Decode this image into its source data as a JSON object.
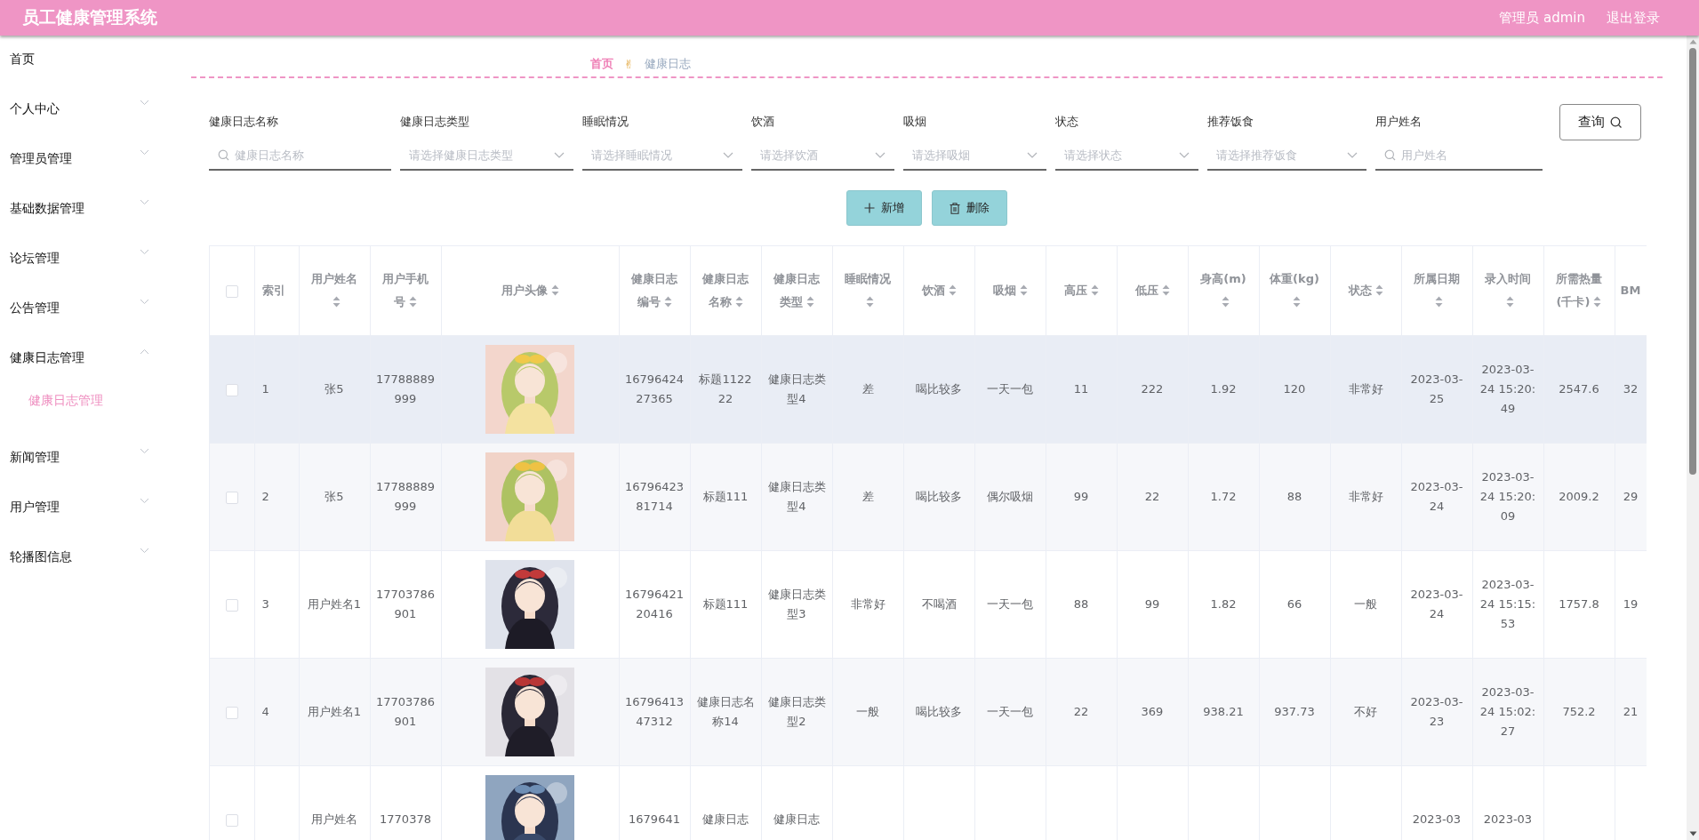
{
  "header": {
    "title": "员工健康管理系统",
    "user": "管理员 admin",
    "logout": "退出登录"
  },
  "sidebar": {
    "items": [
      {
        "label": "首页",
        "kind": "link"
      },
      {
        "label": "个人中心",
        "kind": "menu",
        "expanded": false
      },
      {
        "label": "管理员管理",
        "kind": "menu",
        "expanded": false
      },
      {
        "label": "基础数据管理",
        "kind": "menu",
        "expanded": false
      },
      {
        "label": "论坛管理",
        "kind": "menu",
        "expanded": false
      },
      {
        "label": "公告管理",
        "kind": "menu",
        "expanded": false
      },
      {
        "label": "健康日志管理",
        "kind": "menu",
        "expanded": true,
        "children": [
          {
            "label": "健康日志管理",
            "selected": true
          }
        ]
      },
      {
        "label": "新闻管理",
        "kind": "menu",
        "expanded": false
      },
      {
        "label": "用户管理",
        "kind": "menu",
        "expanded": false
      },
      {
        "label": "轮播图信息",
        "kind": "menu",
        "expanded": false
      }
    ]
  },
  "breadcrumb": {
    "items": [
      "首页",
      "健康日志"
    ],
    "separator": "✌"
  },
  "filters": [
    {
      "label": "健康日志名称",
      "kind": "search",
      "placeholder": "健康日志名称"
    },
    {
      "label": "健康日志类型",
      "kind": "select",
      "placeholder": "请选择健康日志类型"
    },
    {
      "label": "睡眠情况",
      "kind": "select",
      "placeholder": "请选择睡眠情况"
    },
    {
      "label": "饮酒",
      "kind": "select",
      "placeholder": "请选择饮酒"
    },
    {
      "label": "吸烟",
      "kind": "select",
      "placeholder": "请选择吸烟"
    },
    {
      "label": "状态",
      "kind": "select",
      "placeholder": "请选择状态"
    },
    {
      "label": "推荐饭食",
      "kind": "select",
      "placeholder": "请选择推荐饭食"
    },
    {
      "label": "用户姓名",
      "kind": "search",
      "placeholder": "用户姓名"
    }
  ],
  "query_button": "查询",
  "actions": [
    {
      "label": "新增",
      "kind": "add"
    },
    {
      "label": "删除",
      "kind": "delete"
    }
  ],
  "table": {
    "select_all": {
      "checked": false
    },
    "columns": [
      {
        "label": "索引",
        "sortable": false
      },
      {
        "label": "用户姓名",
        "sortable": true
      },
      {
        "label": "用户手机号",
        "sortable": true
      },
      {
        "label": "用户头像",
        "sortable": true
      },
      {
        "label": "健康日志编号",
        "sortable": true
      },
      {
        "label": "健康日志名称",
        "sortable": true
      },
      {
        "label": "健康日志类型",
        "sortable": true
      },
      {
        "label": "睡眠情况",
        "sortable": true
      },
      {
        "label": "饮酒",
        "sortable": true
      },
      {
        "label": "吸烟",
        "sortable": true
      },
      {
        "label": "高压",
        "sortable": true
      },
      {
        "label": "低压",
        "sortable": true
      },
      {
        "label": "身高(m)",
        "sortable": true
      },
      {
        "label": "体重(kg)",
        "sortable": true
      },
      {
        "label": "状态",
        "sortable": true
      },
      {
        "label": "所属日期",
        "sortable": true
      },
      {
        "label": "录入时间",
        "sortable": true
      },
      {
        "label": "所需热量(千卡)",
        "sortable": true
      },
      {
        "label": "BM",
        "sortable": false
      }
    ],
    "rows": [
      {
        "checked": false,
        "hovered": true,
        "cells": [
          "1",
          "张5",
          "17788889999",
          {
            "kind": "picture"
          },
          "1679642427365",
          "标题112222",
          "健康日志类型4",
          "差",
          "喝比较多",
          "一天一包",
          "11",
          "222",
          "1.92",
          "120",
          "非常好",
          "2023-03-25",
          "2023-03-24 15:20:49",
          "2547.6",
          "32"
        ]
      },
      {
        "checked": false,
        "hovered": false,
        "cells": [
          "2",
          "张5",
          "17788889999",
          {
            "kind": "picture"
          },
          "1679642381714",
          "标题111",
          "健康日志类型4",
          "差",
          "喝比较多",
          "偶尔吸烟",
          "99",
          "22",
          "1.72",
          "88",
          "非常好",
          "2023-03-24",
          "2023-03-24 15:20:09",
          "2009.2",
          "29"
        ]
      },
      {
        "checked": false,
        "hovered": false,
        "cells": [
          "3",
          "用户姓名1",
          "17703786901",
          {
            "kind": "picture"
          },
          "1679642120416",
          "标题111",
          "健康日志类型3",
          "非常好",
          "不喝酒",
          "一天一包",
          "88",
          "99",
          "1.82",
          "66",
          "一般",
          "2023-03-24",
          "2023-03-24 15:15:53",
          "1757.8",
          "19"
        ]
      },
      {
        "checked": false,
        "hovered": false,
        "cells": [
          "4",
          "用户姓名1",
          "17703786901",
          {
            "kind": "picture"
          },
          "1679641347312",
          "健康日志名称14",
          "健康日志类型2",
          "一般",
          "喝比较多",
          "一天一包",
          "22",
          "369",
          "938.21",
          "937.73",
          "不好",
          "2023-03-23",
          "2023-03-24 15:02:27",
          "752.2",
          "21"
        ]
      },
      {
        "checked": false,
        "hovered": false,
        "cells": [
          null,
          "用户姓名",
          "1770378",
          {
            "kind": "picture"
          },
          "1679641",
          "健康日志",
          "健康日志",
          null,
          null,
          null,
          null,
          null,
          null,
          null,
          null,
          "2023-03",
          "2023-03",
          null,
          null
        ]
      }
    ]
  }
}
